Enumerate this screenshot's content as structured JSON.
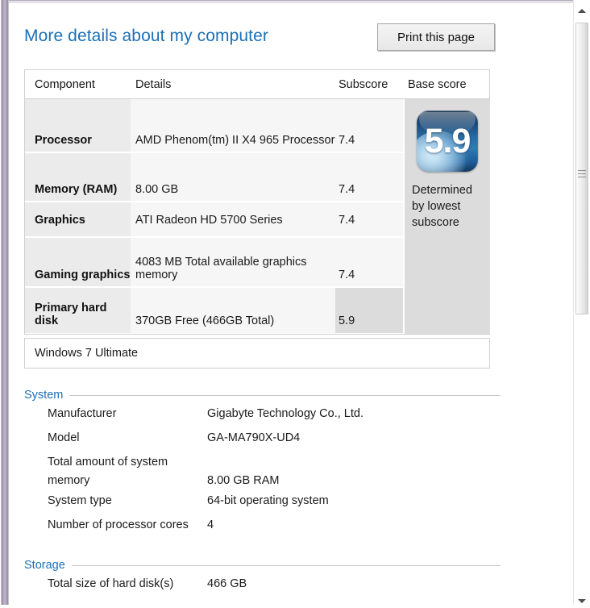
{
  "header": {
    "title": "More details about my computer",
    "print_label": "Print this page"
  },
  "score_table": {
    "columns": {
      "component": "Component",
      "details": "Details",
      "subscore": "Subscore",
      "base_score": "Base score"
    },
    "rows": [
      {
        "component": "Processor",
        "details": "AMD Phenom(tm) II X4 965 Processor",
        "subscore": "7.4"
      },
      {
        "component": "Memory (RAM)",
        "details": "8.00 GB",
        "subscore": "7.4"
      },
      {
        "component": "Graphics",
        "details": "ATI Radeon HD 5700 Series",
        "subscore": "7.4"
      },
      {
        "component": "Gaming graphics",
        "details": "4083 MB Total available graphics memory",
        "subscore": "7.4"
      },
      {
        "component": "Primary hard disk",
        "details": "370GB Free (466GB Total)",
        "subscore": "5.9"
      }
    ],
    "base_score": {
      "value": "5.9",
      "note": "Determined by lowest subscore"
    }
  },
  "os_bar": {
    "edition": "Windows 7 Ultimate"
  },
  "sections": [
    {
      "title": "System",
      "rows": [
        {
          "label": "Manufacturer",
          "value": "Gigabyte Technology Co., Ltd."
        },
        {
          "label": "Model",
          "value": "GA-MA790X-UD4"
        },
        {
          "label": "Total amount of system memory",
          "value": "8.00 GB RAM"
        },
        {
          "label": "System type",
          "value": "64-bit operating system"
        },
        {
          "label": "Number of processor cores",
          "value": "4"
        }
      ]
    },
    {
      "title": "Storage",
      "rows": [
        {
          "label": "Total size of hard disk(s)",
          "value": "466 GB"
        }
      ]
    }
  ],
  "scrollbar": {
    "up_icon": "triangle-up-icon",
    "down_icon": "triangle-down-icon"
  },
  "colors": {
    "accent_blue": "#1c6fb6",
    "badge_dark": "#0d2a49",
    "badge_blue": "#2f79b4",
    "row_component_bg": "#ebebeb",
    "row_detail_bg": "#f6f6f6",
    "highlight_bg": "#dcdcdc",
    "frame_glass": "#a89ab5"
  }
}
